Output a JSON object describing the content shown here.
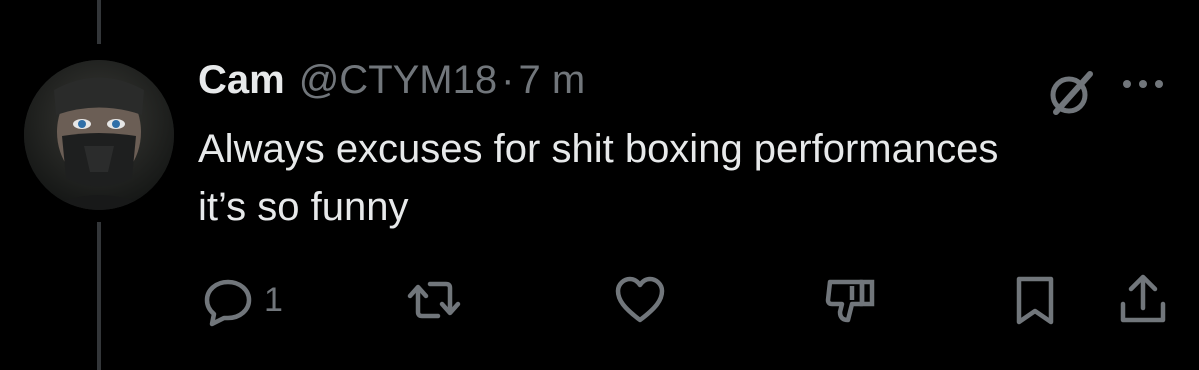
{
  "tweet": {
    "author_name": "Cam",
    "author_handle": "@CTYM18",
    "separator": "·",
    "time": "7 m",
    "text": "Always excuses for shit boxing performances it’s so funny"
  },
  "actions": {
    "reply_count": "1"
  },
  "icons": {
    "avatar": "masked-person-avatar",
    "grok": "grok-icon",
    "more": "more-icon",
    "reply": "reply-icon",
    "retweet": "retweet-icon",
    "like": "heart-icon",
    "dislike": "thumbs-down-icon",
    "bookmark": "bookmark-icon",
    "share": "share-icon"
  },
  "colors": {
    "background": "#000000",
    "primary_text": "#e7e9ea",
    "secondary_text": "#71767b",
    "thread_line": "#333639"
  }
}
